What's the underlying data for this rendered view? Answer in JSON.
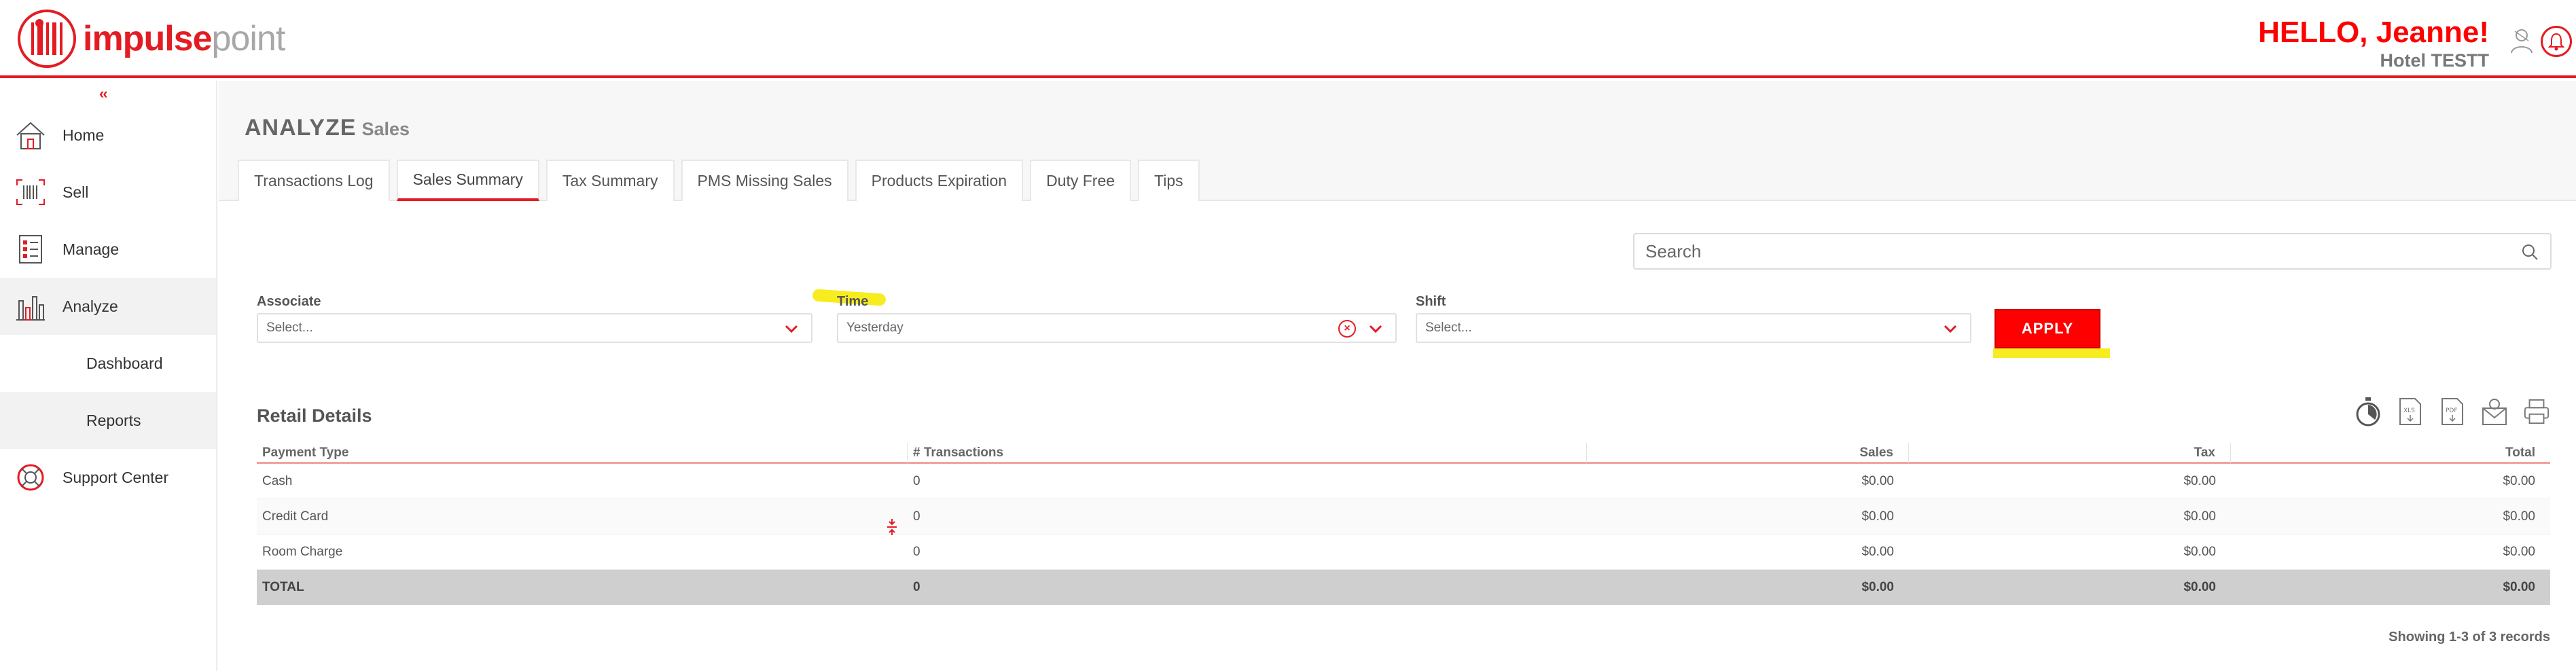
{
  "brand": {
    "logo_bold": "impulse",
    "logo_light": "point"
  },
  "header": {
    "greeting": "HELLO, Jeanne!",
    "hotel": "Hotel TESTT"
  },
  "sidebar": {
    "collapse": "‹‹",
    "items": [
      {
        "label": "Home",
        "icon": "house-icon"
      },
      {
        "label": "Sell",
        "icon": "barcode-scan-icon"
      },
      {
        "label": "Manage",
        "icon": "checklist-icon"
      },
      {
        "label": "Analyze",
        "icon": "bar-chart-icon"
      },
      {
        "label": "Dashboard"
      },
      {
        "label": "Reports"
      },
      {
        "label": "Support Center",
        "icon": "lifebuoy-icon"
      }
    ]
  },
  "page": {
    "title": "ANALYZE",
    "subtitle": "Sales"
  },
  "tabs": [
    {
      "label": "Transactions Log"
    },
    {
      "label": "Sales Summary",
      "active": true
    },
    {
      "label": "Tax Summary"
    },
    {
      "label": "PMS Missing Sales"
    },
    {
      "label": "Products Expiration"
    },
    {
      "label": "Duty Free"
    },
    {
      "label": "Tips"
    }
  ],
  "search": {
    "placeholder": "Search"
  },
  "filters": {
    "associate": {
      "label": "Associate",
      "value": "Select..."
    },
    "time": {
      "label": "Time",
      "value": "Yesterday"
    },
    "shift": {
      "label": "Shift",
      "value": "Select..."
    },
    "apply_label": "APPLY"
  },
  "retail": {
    "title": "Retail Details",
    "columns": [
      "Payment Type",
      "# Transactions",
      "Sales",
      "Tax",
      "Total"
    ],
    "rows": [
      [
        "Cash",
        "0",
        "$0.00",
        "$0.00",
        "$0.00"
      ],
      [
        "Credit Card",
        "0",
        "$0.00",
        "$0.00",
        "$0.00"
      ],
      [
        "Room Charge",
        "0",
        "$0.00",
        "$0.00",
        "$0.00"
      ]
    ],
    "total": [
      "TOTAL",
      "0",
      "$0.00",
      "$0.00",
      "$0.00"
    ],
    "footer": "Showing 1-3 of 3 records"
  },
  "colors": {
    "accent": "#e31c23",
    "apply": "#ff0000",
    "highlight": "#f7ec20"
  }
}
